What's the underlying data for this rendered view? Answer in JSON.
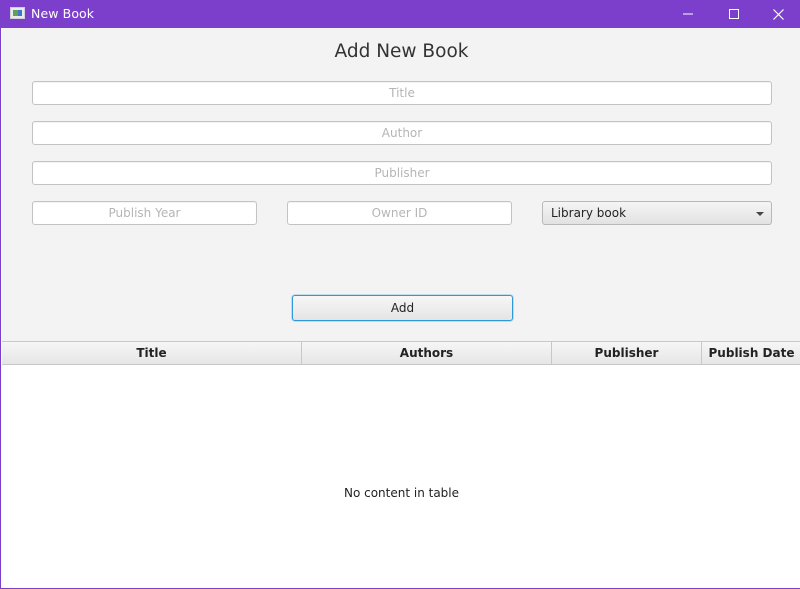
{
  "window": {
    "title": "New Book",
    "accent_color": "#7c3fcb",
    "icons": [
      "app-icon",
      "minimize-icon",
      "maximize-icon",
      "close-icon"
    ]
  },
  "form": {
    "heading": "Add New Book",
    "title_placeholder": "Title",
    "title_value": "",
    "author_placeholder": "Author",
    "author_value": "",
    "publisher_placeholder": "Publisher",
    "publisher_value": "",
    "publish_year_placeholder": "Publish Year",
    "publish_year_value": "",
    "owner_id_placeholder": "Owner ID",
    "owner_id_value": "",
    "book_type_selected": "Library book",
    "add_label": "Add"
  },
  "table": {
    "columns": [
      "Title",
      "Authors",
      "Publisher",
      "Publish Date"
    ],
    "rows": [],
    "empty_text": "No content in table"
  }
}
